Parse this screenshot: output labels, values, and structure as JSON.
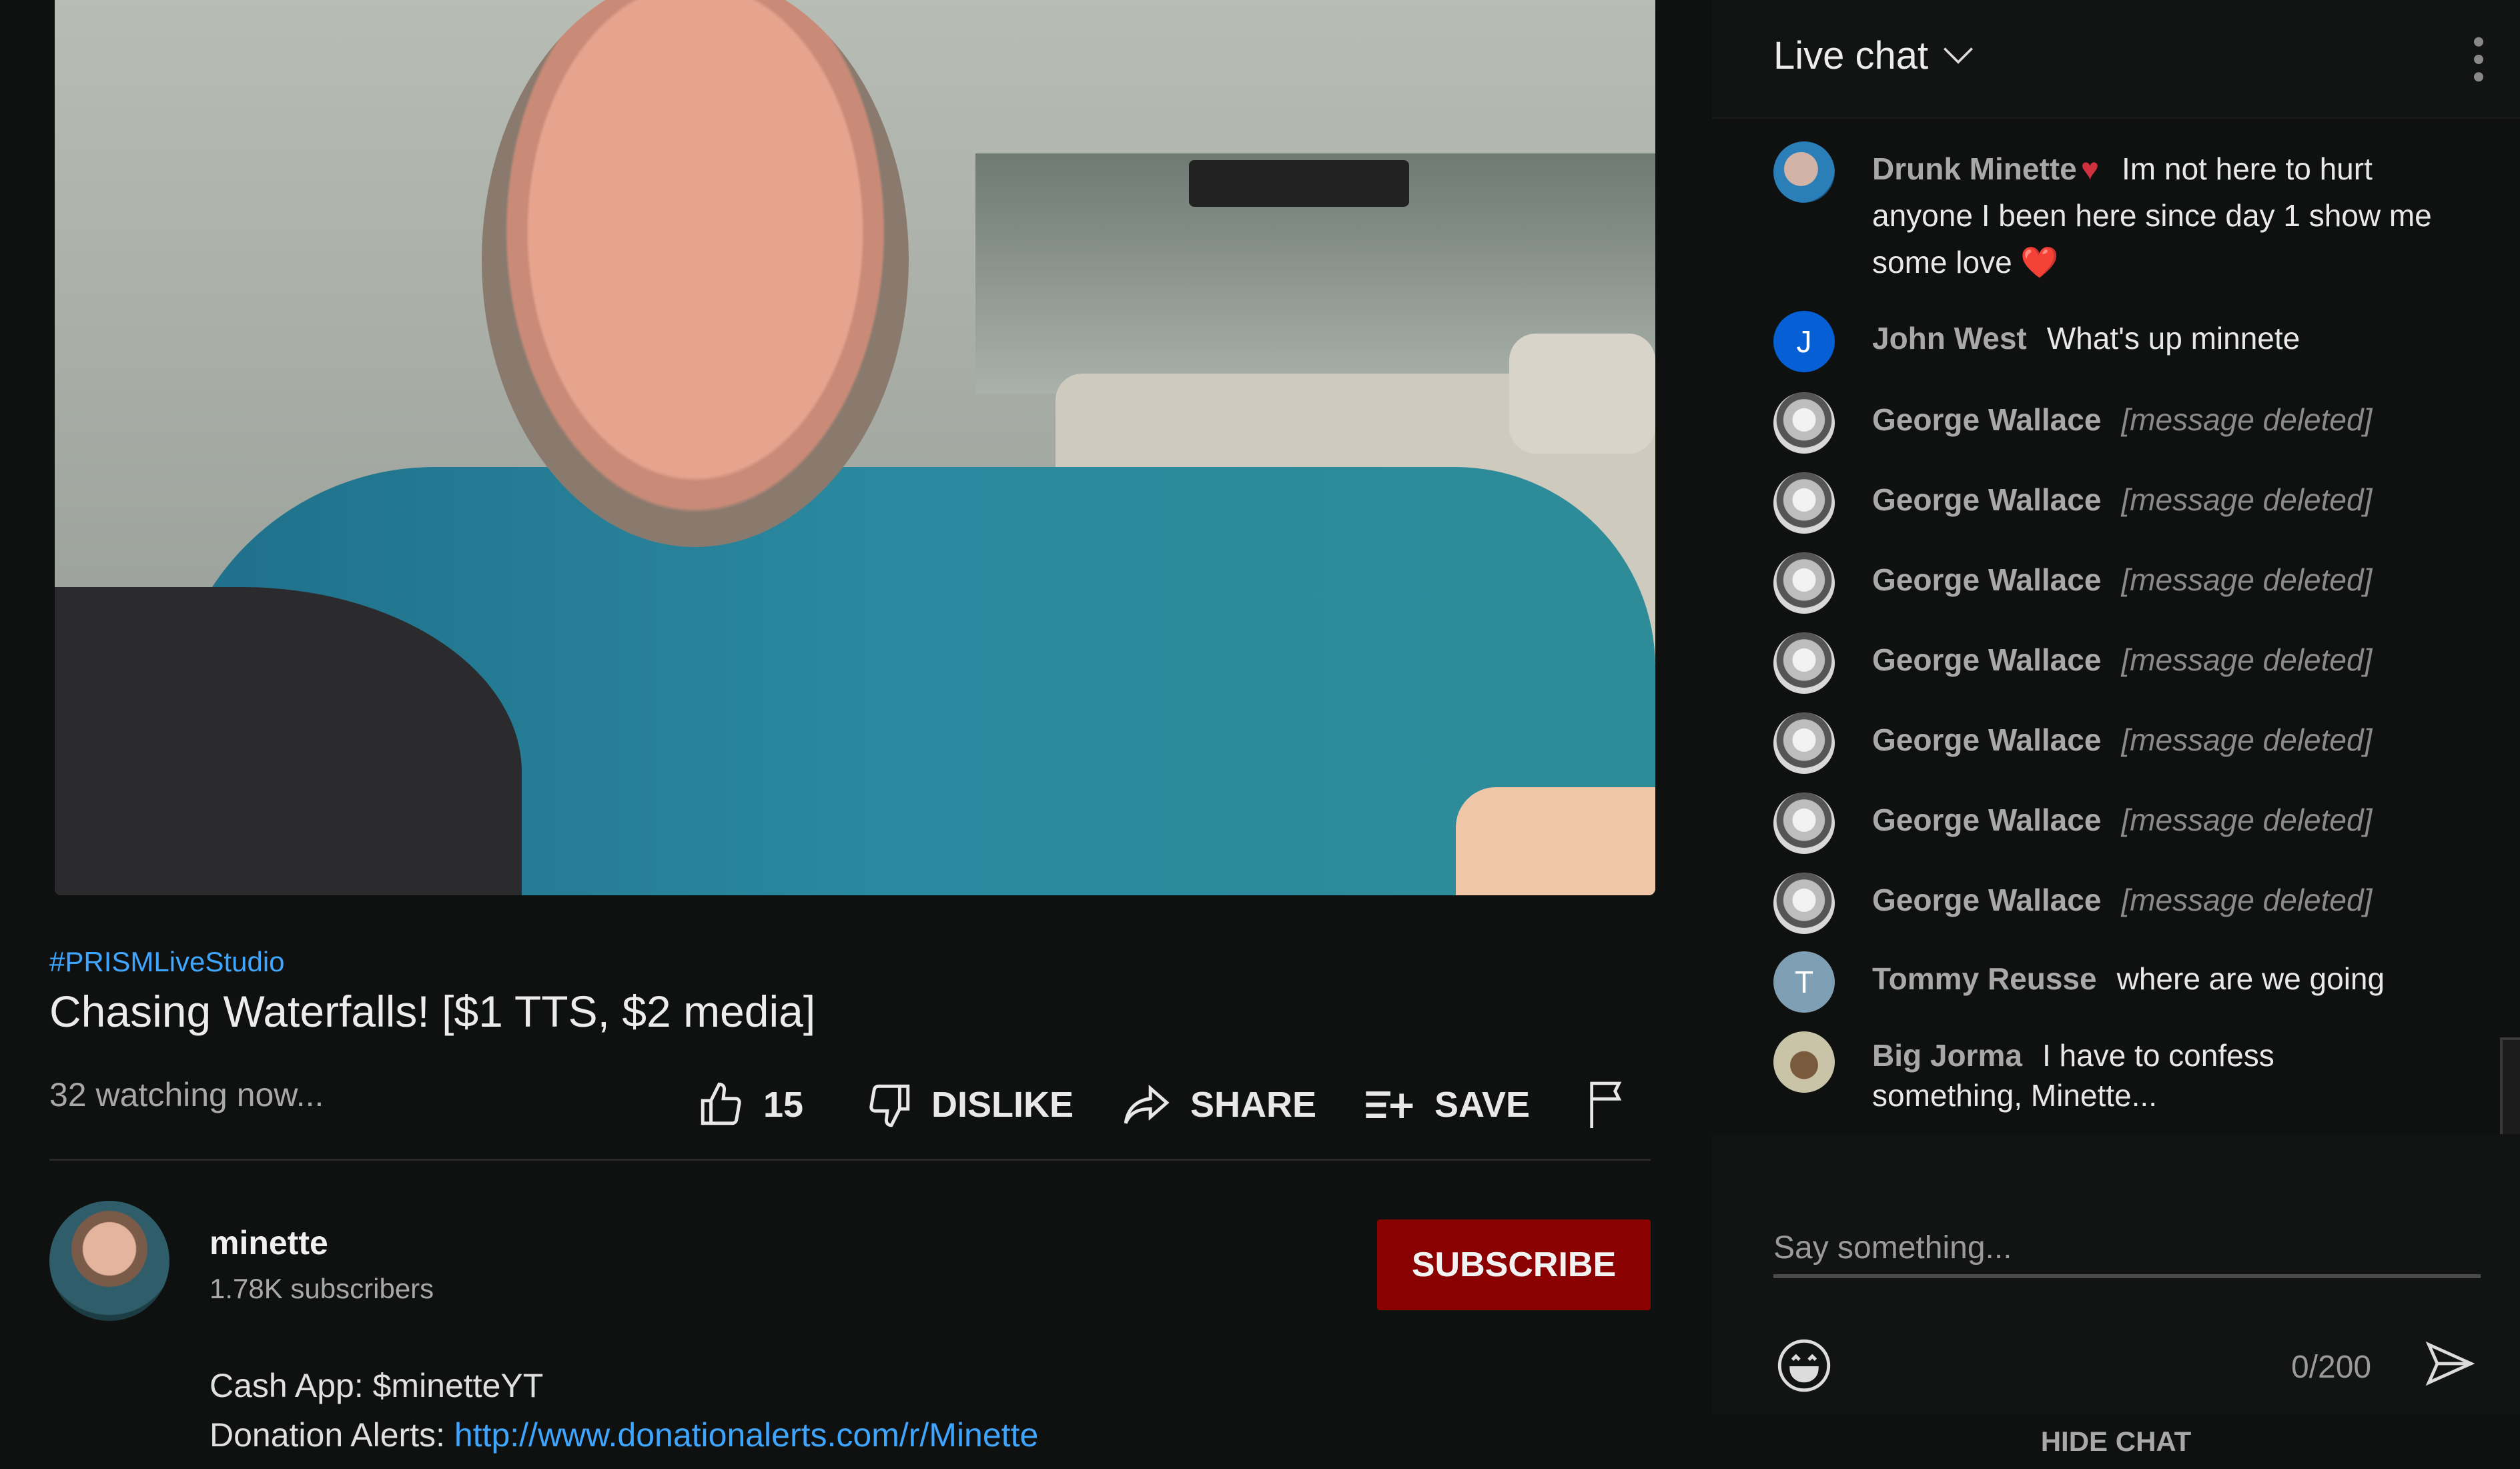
{
  "video": {
    "hashtag": "#PRISMLiveStudio",
    "title": "Chasing Waterfalls! [$1 TTS, $2 media]",
    "viewers": "32 watching now...",
    "actions": {
      "like_count": "15",
      "dislike_label": "DISLIKE",
      "share_label": "SHARE",
      "save_label": "SAVE"
    }
  },
  "channel": {
    "name": "minette",
    "subscribers": "1.78K subscribers",
    "subscribe_label": "SUBSCRIBE",
    "subscribe_color": "#8b0000"
  },
  "description": {
    "line1": "Cash App: $minetteYT",
    "line2_prefix": "Donation Alerts: ",
    "line2_link": "http://www.donationalerts.com/r/Minette"
  },
  "chat": {
    "title": "Live chat",
    "messages": [
      {
        "author": "Drunk Minette",
        "badge": "♥",
        "text": "Im not here to hurt anyone I been here since day 1 show me some love ❤️",
        "avatar": "photo"
      },
      {
        "author": "John West",
        "text": "What's up minnete",
        "avatar_letter": "J",
        "avatar_color": "#065fd4"
      },
      {
        "author": "George Wallace",
        "text": "[message deleted]",
        "deleted": true
      },
      {
        "author": "George Wallace",
        "text": "[message deleted]",
        "deleted": true
      },
      {
        "author": "George Wallace",
        "text": "[message deleted]",
        "deleted": true
      },
      {
        "author": "George Wallace",
        "text": "[message deleted]",
        "deleted": true
      },
      {
        "author": "George Wallace",
        "text": "[message deleted]",
        "deleted": true
      },
      {
        "author": "George Wallace",
        "text": "[message deleted]",
        "deleted": true
      },
      {
        "author": "George Wallace",
        "text": "[message deleted]",
        "deleted": true
      },
      {
        "author": "Tommy Reusse",
        "text": "where are we going",
        "avatar_letter": "T",
        "avatar_color": "#7f9fb4"
      },
      {
        "author": "Big Jorma",
        "text": "I have to confess something, Minette...",
        "avatar": "photo"
      }
    ],
    "input_placeholder": "Say something...",
    "char_count": "0/200",
    "hide_label": "HIDE CHAT"
  }
}
